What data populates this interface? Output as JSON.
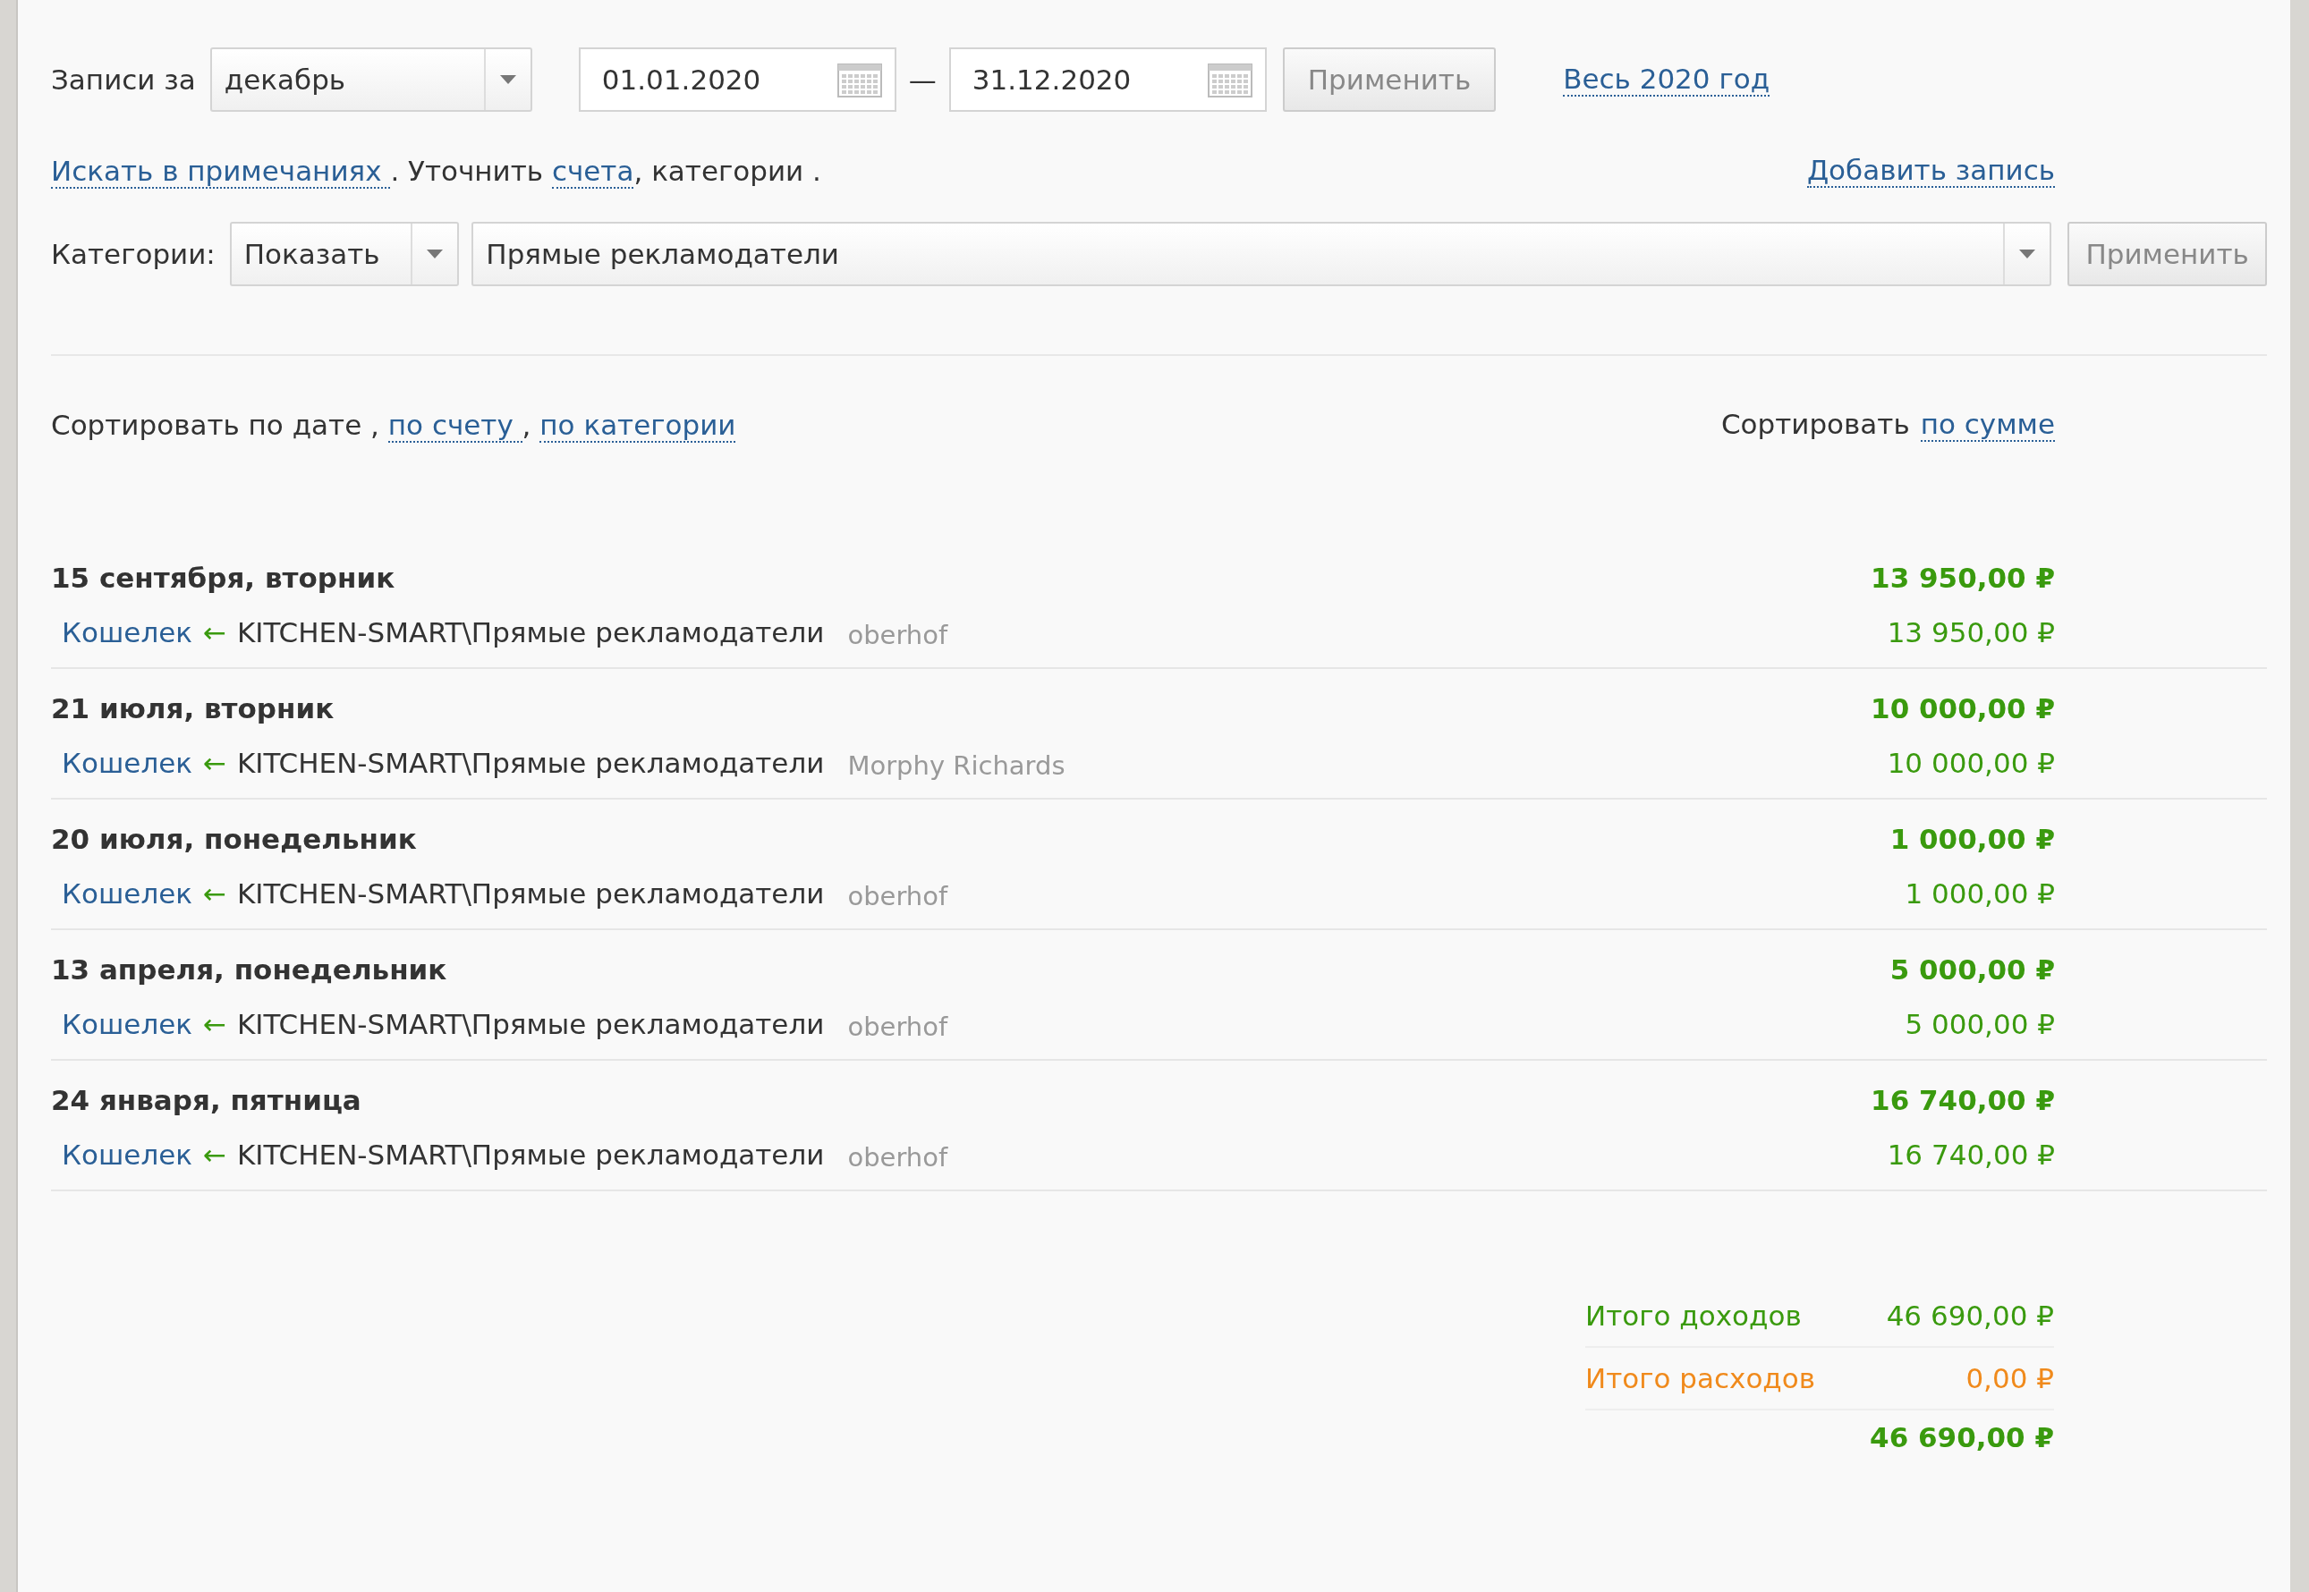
{
  "period": {
    "label": "Записи за",
    "month": "декабрь",
    "date_from": "01.01.2020",
    "separator": "—",
    "date_to": "31.12.2020",
    "apply": "Применить",
    "whole_year_link": "Весь 2020 год"
  },
  "refine": {
    "parts": [
      {
        "kind": "link",
        "text": "Искать в примечаниях "
      },
      {
        "kind": "text",
        "text": ". Уточнить "
      },
      {
        "kind": "link",
        "text": "счета"
      },
      {
        "kind": "text",
        "text": ", категории ."
      }
    ],
    "add_link": "Добавить запись"
  },
  "categories": {
    "label": "Категории:",
    "mode": "Показать",
    "category": "Прямые рекламодатели",
    "apply": "Применить"
  },
  "sort": {
    "parts": [
      {
        "kind": "text",
        "text": "Сортировать по дате , "
      },
      {
        "kind": "link",
        "text": "по счету "
      },
      {
        "kind": "text",
        "text": ", "
      },
      {
        "kind": "link",
        "text": "по категории"
      }
    ],
    "right_label": "Сортировать",
    "right_link": "по сумме"
  },
  "days": [
    {
      "date": "15 сентября, вторник",
      "total": "13 950,00 ₽",
      "entries": [
        {
          "account": "Кошелек",
          "arrow": "←",
          "category": "KITCHEN-SMART\\Прямые рекламодатели",
          "note": "oberhof",
          "amount": "13 950,00 ₽"
        }
      ]
    },
    {
      "date": "21 июля, вторник",
      "total": "10 000,00 ₽",
      "entries": [
        {
          "account": "Кошелек",
          "arrow": "←",
          "category": "KITCHEN-SMART\\Прямые рекламодатели",
          "note": "Morphy Richards",
          "amount": "10 000,00 ₽"
        }
      ]
    },
    {
      "date": "20 июля, понедельник",
      "total": "1 000,00 ₽",
      "entries": [
        {
          "account": "Кошелек",
          "arrow": "←",
          "category": "KITCHEN-SMART\\Прямые рекламодатели",
          "note": "oberhof",
          "amount": "1 000,00 ₽"
        }
      ]
    },
    {
      "date": "13 апреля, понедельник",
      "total": "5 000,00 ₽",
      "entries": [
        {
          "account": "Кошелек",
          "arrow": "←",
          "category": "KITCHEN-SMART\\Прямые рекламодатели",
          "note": "oberhof",
          "amount": "5 000,00 ₽"
        }
      ]
    },
    {
      "date": "24 января, пятница",
      "total": "16 740,00 ₽",
      "entries": [
        {
          "account": "Кошелек",
          "arrow": "←",
          "category": "KITCHEN-SMART\\Прямые рекламодатели",
          "note": "oberhof",
          "amount": "16 740,00 ₽"
        }
      ]
    }
  ],
  "totals": [
    {
      "kind": "income",
      "label": "Итого доходов",
      "value": "46 690,00 ₽"
    },
    {
      "kind": "expense",
      "label": "Итого расходов",
      "value": "0,00 ₽"
    }
  ],
  "grand_total": "46 690,00 ₽"
}
